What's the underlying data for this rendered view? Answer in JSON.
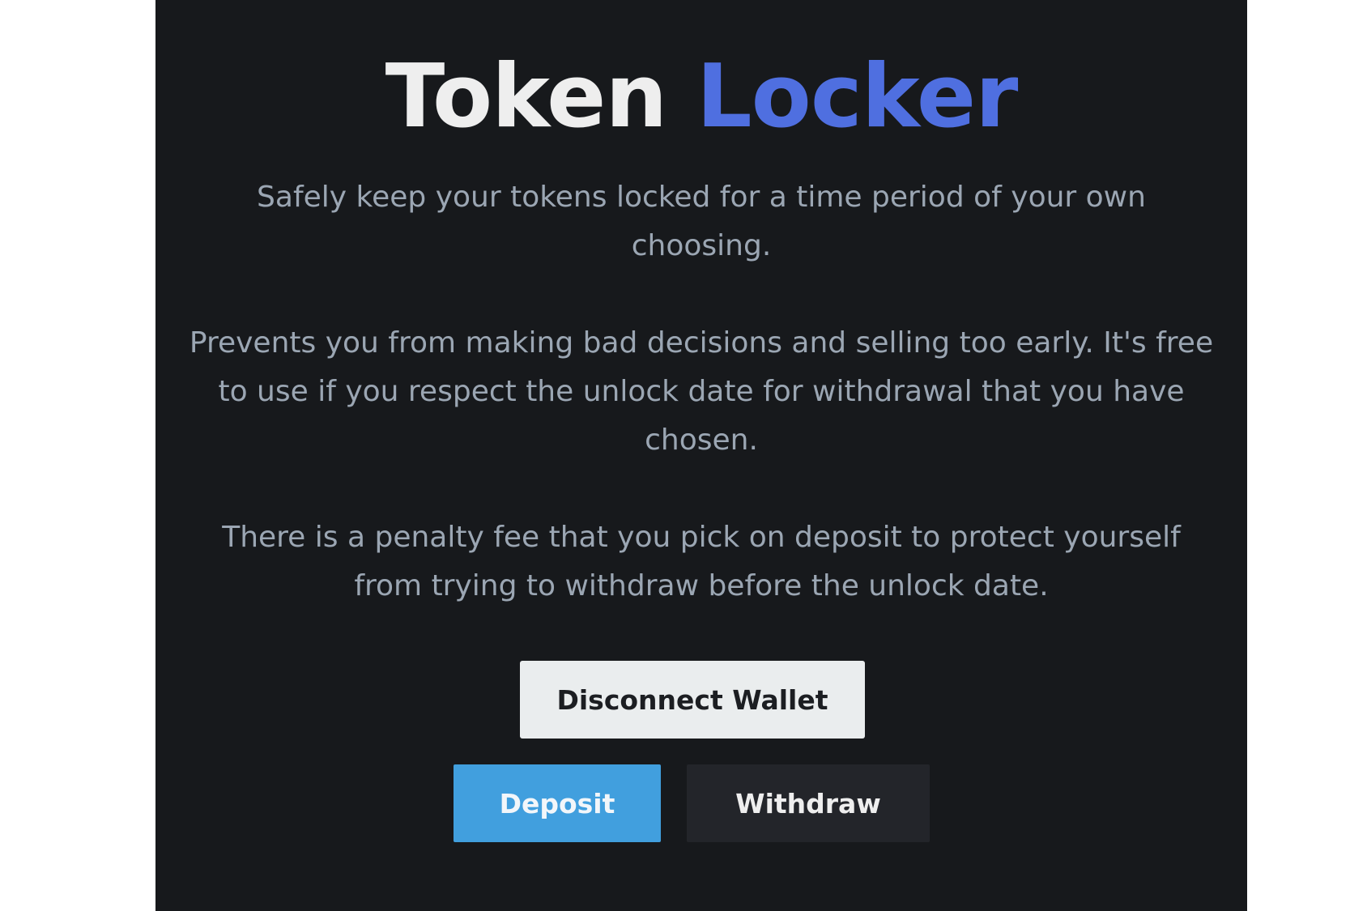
{
  "header": {
    "title_part1": "Token",
    "title_part2": "Locker"
  },
  "intro": {
    "line1": "Safely keep your tokens locked for a time period of your own choosing.",
    "line2": "Prevents you from making bad decisions and selling too early. It's free to use if you respect the unlock date for withdrawal that you have chosen.",
    "line3": "There is a penalty fee that you pick on deposit to protect yourself from trying to withdraw before the unlock date."
  },
  "actions": {
    "disconnect_label": "Disconnect Wallet",
    "deposit_label": "Deposit",
    "withdraw_label": "Withdraw"
  },
  "colors": {
    "background": "#17191c",
    "accent_title": "#4f6fe0",
    "deposit_button": "#419fde",
    "withdraw_button": "#23252a",
    "disconnect_button": "#eaedee",
    "body_text": "#9ba6b3"
  }
}
